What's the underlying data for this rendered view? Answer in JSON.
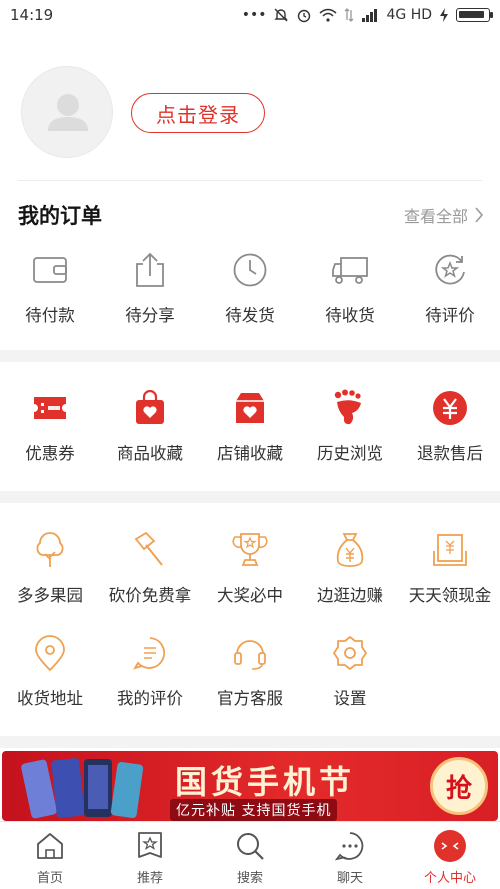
{
  "status": {
    "time": "14:19",
    "network": "4G HD",
    "indicators": [
      "dots-icon",
      "mute-icon",
      "alarm-icon",
      "wifi-icon",
      "data-icon",
      "signal-icon",
      "charging-icon",
      "battery-icon"
    ],
    "battery_level": 0.9
  },
  "profile": {
    "login_label": "点击登录"
  },
  "orders": {
    "title": "我的订单",
    "view_all": "查看全部",
    "items": [
      {
        "label": "待付款",
        "icon": "wallet-icon"
      },
      {
        "label": "待分享",
        "icon": "share-icon"
      },
      {
        "label": "待发货",
        "icon": "clock-icon"
      },
      {
        "label": "待收货",
        "icon": "truck-icon"
      },
      {
        "label": "待评价",
        "icon": "review-star-icon"
      }
    ]
  },
  "services": {
    "items": [
      {
        "label": "优惠券",
        "icon": "coupon-icon"
      },
      {
        "label": "商品收藏",
        "icon": "bag-heart-icon"
      },
      {
        "label": "店铺收藏",
        "icon": "shop-heart-icon"
      },
      {
        "label": "历史浏览",
        "icon": "footprint-icon"
      },
      {
        "label": "退款售后",
        "icon": "refund-icon"
      }
    ]
  },
  "tools": {
    "row1": [
      {
        "label": "多多果园",
        "icon": "tree-icon"
      },
      {
        "label": "砍价免费拿",
        "icon": "axe-icon"
      },
      {
        "label": "大奖必中",
        "icon": "trophy-icon"
      },
      {
        "label": "边逛边赚",
        "icon": "money-bag-icon"
      },
      {
        "label": "天天领现金",
        "icon": "cash-envelope-icon"
      }
    ],
    "row2": [
      {
        "label": "收货地址",
        "icon": "location-icon"
      },
      {
        "label": "我的评价",
        "icon": "comment-icon"
      },
      {
        "label": "官方客服",
        "icon": "headset-icon"
      },
      {
        "label": "设置",
        "icon": "settings-icon"
      }
    ]
  },
  "banner": {
    "title": "国货手机节",
    "subtitle": "亿元补贴 支持国货手机",
    "action": "抢"
  },
  "nav": {
    "items": [
      {
        "label": "首页",
        "icon": "home-icon"
      },
      {
        "label": "推荐",
        "icon": "recommend-icon"
      },
      {
        "label": "搜索",
        "icon": "search-icon"
      },
      {
        "label": "聊天",
        "icon": "chat-icon"
      },
      {
        "label": "个人中心",
        "icon": "profile-icon"
      }
    ],
    "active_index": 4
  },
  "colors": {
    "accent": "#e0312b",
    "icon_gray": "#8a8a8a",
    "icon_orange": "#f0a050"
  }
}
